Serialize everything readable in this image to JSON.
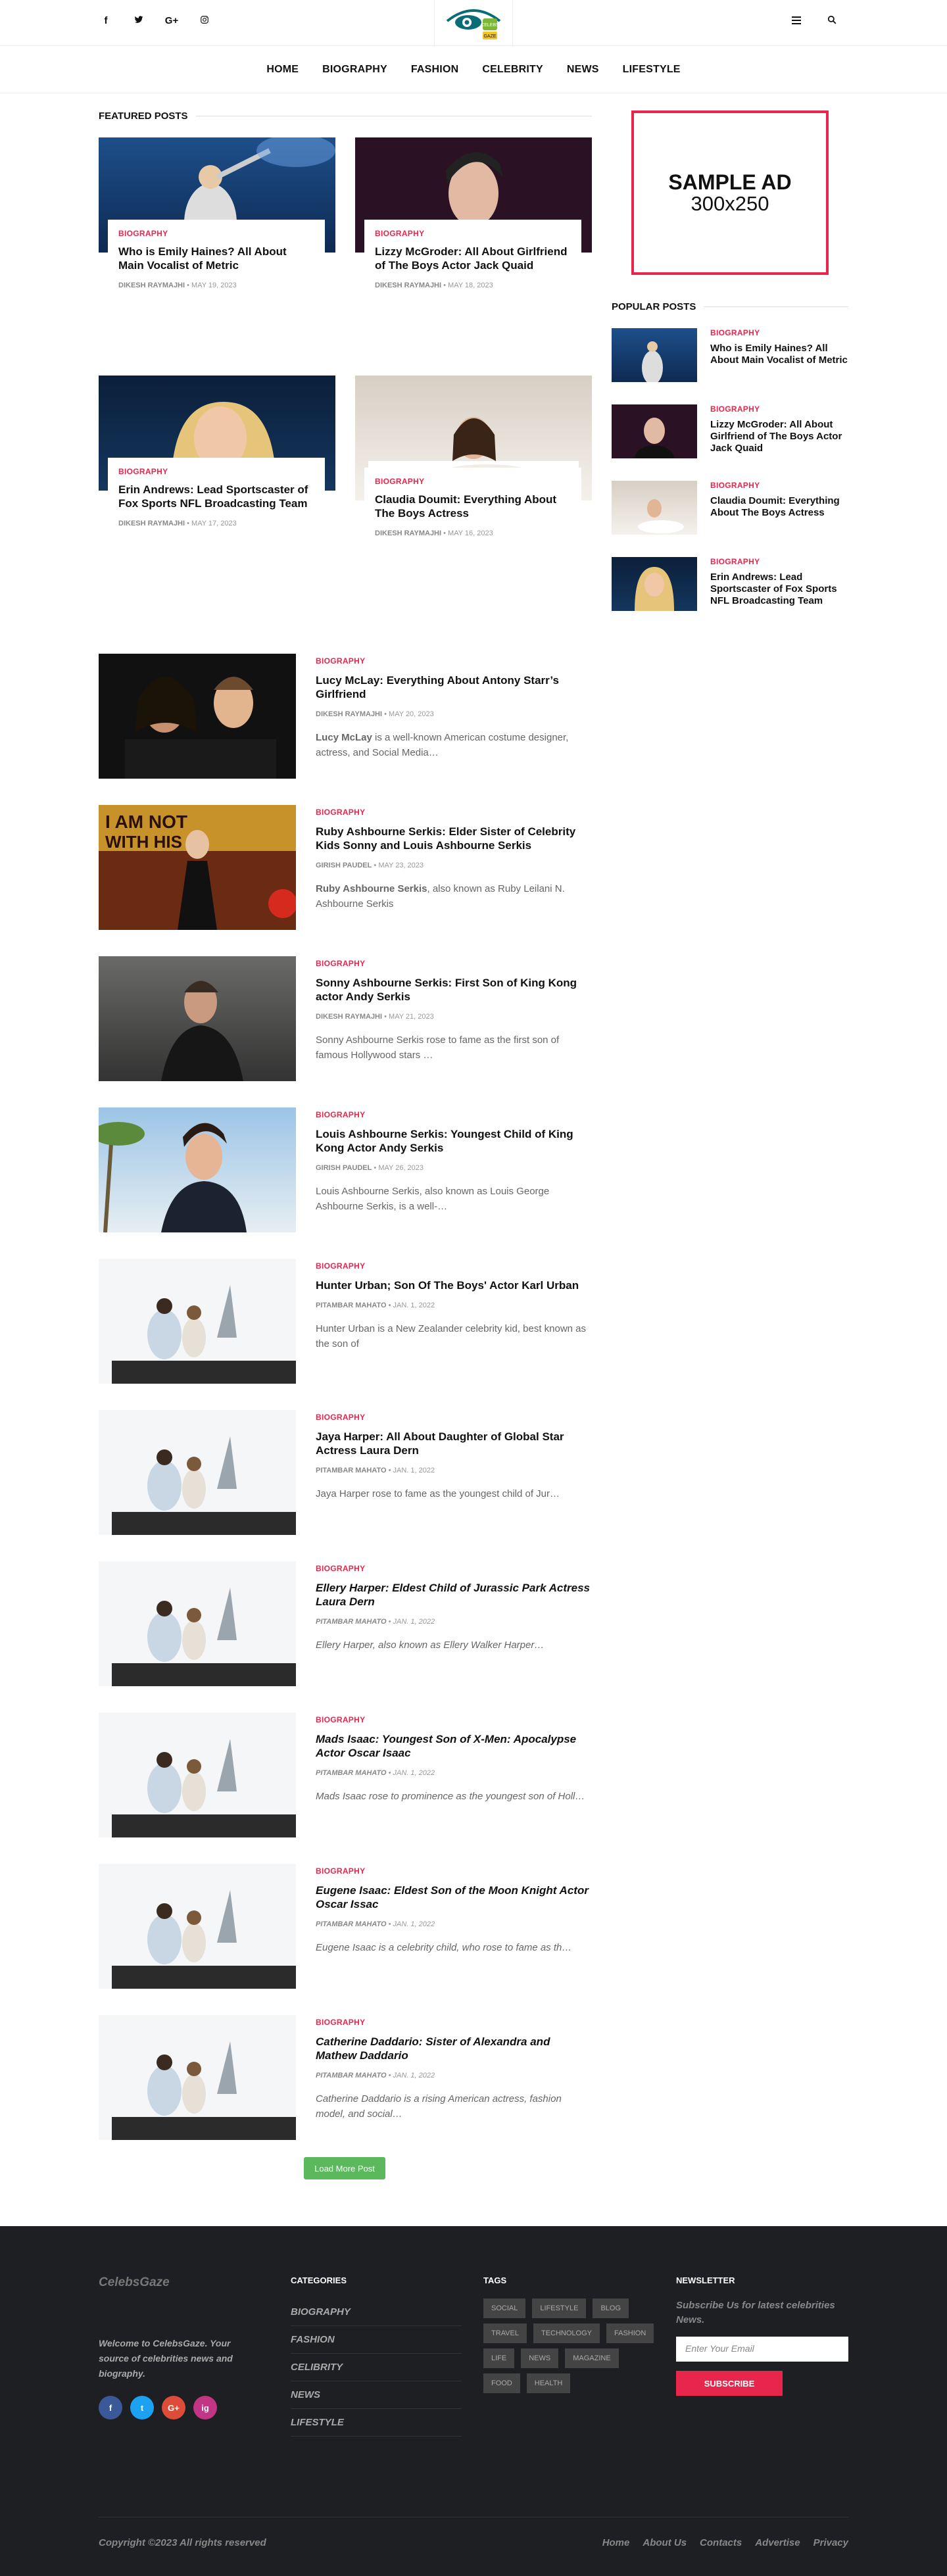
{
  "header": {
    "social": [
      "f",
      "t",
      "G+",
      "ig"
    ],
    "logo_text": "CELEBS GAZE",
    "menu_icon": "menu-icon",
    "search_icon": "search-icon"
  },
  "nav": [
    "HOME",
    "BIOGRAPHY",
    "FASHION",
    "CELEBRITY",
    "NEWS",
    "LIFESTYLE"
  ],
  "featured": {
    "title": "FEATURED POSTS",
    "posts": [
      {
        "category": "BIOGRAPHY",
        "title": "Who is Emily Haines? All About Main Vocalist of Metric",
        "author": "DIKESH RAYMAJHI",
        "date": "MAY 19, 2023"
      },
      {
        "category": "BIOGRAPHY",
        "title": "Lizzy McGroder: All About Girlfriend of The Boys Actor Jack Quaid",
        "author": "DIKESH RAYMAJHI",
        "date": "MAY 18, 2023"
      },
      {
        "category": "BIOGRAPHY",
        "title": "Erin Andrews: Lead Sportscaster of Fox Sports NFL Broadcasting Team",
        "author": "DIKESH RAYMAJHI",
        "date": "MAY 17, 2023"
      },
      {
        "category": "BIOGRAPHY",
        "title": "Claudia Doumit: Everything About The Boys Actress",
        "author": "DIKESH RAYMAJHI",
        "date": "MAY 16, 2023"
      }
    ]
  },
  "list": [
    {
      "category": "BIOGRAPHY",
      "title": "Lucy McLay: Everything About Antony Starr’s Girlfriend",
      "author": "DIKESH RAYMAJHI",
      "date": "MAY 20, 2023",
      "excerpt_bold": "Lucy McLay",
      "excerpt": " is a well-known American costume designer, actress, and Social Media…"
    },
    {
      "category": "BIOGRAPHY",
      "title": "Ruby Ashbourne Serkis: Elder Sister of Celebrity Kids Sonny and Louis Ashbourne Serkis",
      "author": "GIRISH PAUDEL",
      "date": "MAY 23, 2023",
      "excerpt_bold": "Ruby Ashbourne Serkis",
      "excerpt": ", also known as Ruby Leilani N. Ashbourne Serkis"
    },
    {
      "category": "BIOGRAPHY",
      "title": "Sonny Ashbourne Serkis: First Son of King Kong actor Andy Serkis",
      "author": "DIKESH RAYMAJHI",
      "date": "MAY 21, 2023",
      "excerpt_bold": "",
      "excerpt": "Sonny Ashbourne Serkis rose to fame as the first son of famous Hollywood stars …"
    },
    {
      "category": "BIOGRAPHY",
      "title": "Louis Ashbourne Serkis: Youngest Child of King Kong Actor Andy Serkis",
      "author": "GIRISH PAUDEL",
      "date": "MAY 26, 2023",
      "excerpt_bold": "",
      "excerpt": "Louis Ashbourne Serkis, also known as Louis George Ashbourne Serkis, is a well-…"
    },
    {
      "category": "BIOGRAPHY",
      "title": "Hunter Urban; Son Of The Boys' Actor Karl Urban",
      "author": "PITAMBAR MAHATO",
      "date": "JAN. 1, 2022",
      "excerpt_bold": "",
      "excerpt": "Hunter Urban is a New Zealander celebrity kid, best known as the son of"
    },
    {
      "category": "BIOGRAPHY",
      "title": "Jaya Harper: All About Daughter of Global Star Actress Laura Dern",
      "author": "PITAMBAR MAHATO",
      "date": "JAN. 1, 2022",
      "excerpt_bold": "",
      "excerpt": "Jaya Harper rose to fame as the youngest child of Jur…"
    },
    {
      "category": "BIOGRAPHY",
      "title": "Ellery Harper: Eldest Child of Jurassic Park Actress Laura Dern",
      "author": "PITAMBAR MAHATO",
      "date": "JAN. 1, 2022",
      "excerpt_bold": "",
      "excerpt": "Ellery Harper, also known as Ellery Walker Harper…"
    },
    {
      "category": "BIOGRAPHY",
      "title": "Mads Isaac: Youngest Son of X-Men: Apocalypse Actor Oscar Isaac",
      "author": "PITAMBAR MAHATO",
      "date": "JAN. 1, 2022",
      "excerpt_bold": "",
      "excerpt": "Mads Isaac rose to prominence as the youngest son of Holl…"
    },
    {
      "category": "BIOGRAPHY",
      "title": "Eugene Isaac: Eldest Son of the Moon Knight Actor Oscar Issac",
      "author": "PITAMBAR MAHATO",
      "date": "JAN. 1, 2022",
      "excerpt_bold": "",
      "excerpt": "Eugene Isaac is a celebrity child, who rose to fame as th…"
    },
    {
      "category": "BIOGRAPHY",
      "title": "Catherine Daddario: Sister of Alexandra and Mathew Daddario",
      "author": "PITAMBAR MAHATO",
      "date": "JAN. 1, 2022",
      "excerpt_bold": "",
      "excerpt": "Catherine Daddario is a rising American actress, fashion model, and social…"
    }
  ],
  "load_more": "Load More Post",
  "sidebar": {
    "ad_line1": "SAMPLE AD",
    "ad_line2": "300x250",
    "popular_title": "POPULAR POSTS",
    "popular": [
      {
        "category": "BIOGRAPHY",
        "title": "Who is Emily Haines? All About Main Vocalist of Metric"
      },
      {
        "category": "BIOGRAPHY",
        "title": "Lizzy McGroder: All About Girlfriend of The Boys Actor Jack Quaid"
      },
      {
        "category": "BIOGRAPHY",
        "title": "Claudia Doumit: Everything About The Boys Actress"
      },
      {
        "category": "BIOGRAPHY",
        "title": "Erin Andrews: Lead Sportscaster of Fox Sports NFL Broadcasting Team"
      }
    ]
  },
  "footer": {
    "logo": "CelebsGaze",
    "desc": "Welcome to CelebsGaze. Your source of celebrities news and biography.",
    "social": [
      "f",
      "t",
      "G+",
      "ig"
    ],
    "categories_title": "CATEGORIES",
    "categories": [
      "BIOGRAPHY",
      "FASHION",
      "CELIBRITY",
      "NEWS",
      "LIFESTYLE"
    ],
    "tags_title": "TAGS",
    "tags": [
      "SOCIAL",
      "LIFESTYLE",
      "BLOG",
      "TRAVEL",
      "TECHNOLOGY",
      "FASHION",
      "LIFE",
      "NEWS",
      "MAGAZINE",
      "FOOD",
      "HEALTH"
    ],
    "newsletter_title": "NEWSLETTER",
    "newsletter_text": "Subscribe Us for latest celebrities News.",
    "newsletter_placeholder": "Enter Your Email",
    "subscribe": "SUBSCRIBE",
    "copyright": "Copyright ©2023 All rights reserved",
    "links": [
      "Home",
      "About Us",
      "Contacts",
      "Advertise",
      "Privacy"
    ]
  },
  "colors": {
    "accent": "#e8264c",
    "green": "#5cb85c",
    "footer_bg": "#1e1f22"
  }
}
